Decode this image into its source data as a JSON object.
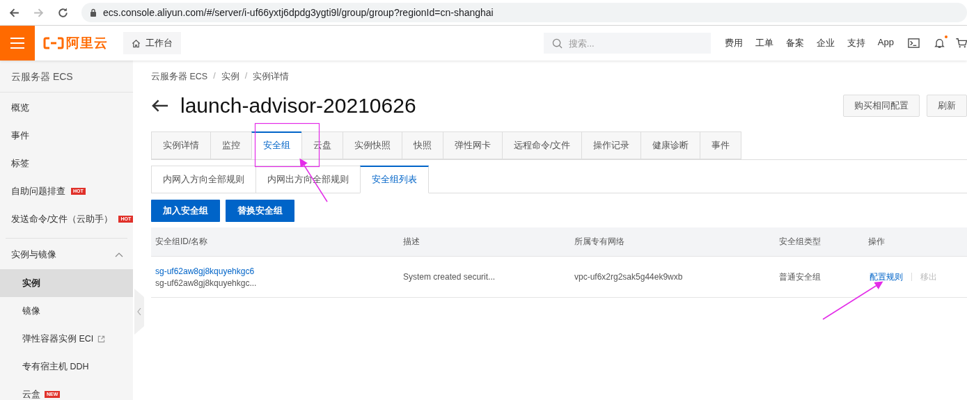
{
  "browser": {
    "url": "ecs.console.aliyun.com/#/server/i-uf66yxtj6dpdg3ygti9l/group/group?regionId=cn-shanghai"
  },
  "header": {
    "logo": "阿里云",
    "workbench": "工作台",
    "search": {
      "placeholder": "搜索..."
    },
    "nav": [
      "费用",
      "工单",
      "备案",
      "企业",
      "支持",
      "App"
    ],
    "notification_dot": true
  },
  "sidebar": {
    "title": "云服务器 ECS",
    "items": [
      {
        "label": "概览"
      },
      {
        "label": "事件"
      },
      {
        "label": "标签"
      },
      {
        "label": "自助问题排查",
        "badge": "HOT"
      },
      {
        "label": "发送命令/文件（云助手）",
        "badge": "HOT"
      }
    ],
    "group": {
      "label": "实例与镜像",
      "expanded": true,
      "children": [
        {
          "label": "实例",
          "selected": true
        },
        {
          "label": "镜像",
          "selected": false
        },
        {
          "label": "弹性容器实例 ECI",
          "selected": false,
          "external": true
        },
        {
          "label": "专有宿主机 DDH",
          "selected": false
        },
        {
          "label": "云盒",
          "selected": false,
          "badge": "NEW"
        }
      ]
    }
  },
  "breadcrumb": {
    "items": [
      "云服务器 ECS",
      "实例",
      "实例详情"
    ],
    "separator": "/"
  },
  "title": "launch-advisor-20210626",
  "actions": [
    "购买相同配置",
    "刷新"
  ],
  "tabs": [
    {
      "label": "实例详情",
      "selected": false
    },
    {
      "label": "监控",
      "selected": false
    },
    {
      "label": "安全组",
      "selected": true
    },
    {
      "label": "云盘",
      "selected": false
    },
    {
      "label": "实例快照",
      "selected": false
    },
    {
      "label": "快照",
      "selected": false
    },
    {
      "label": "弹性网卡",
      "selected": false
    },
    {
      "label": "远程命令/文件",
      "selected": false
    },
    {
      "label": "操作记录",
      "selected": false
    },
    {
      "label": "健康诊断",
      "selected": false
    },
    {
      "label": "事件",
      "selected": false
    }
  ],
  "subtabs": [
    {
      "label": "内网入方向全部规则",
      "selected": false
    },
    {
      "label": "内网出方向全部规则",
      "selected": false
    },
    {
      "label": "安全组列表",
      "selected": true
    }
  ],
  "buttons": [
    "加入安全组",
    "替换安全组"
  ],
  "table": {
    "columns": [
      "安全组ID/名称",
      "描述",
      "所属专有网络",
      "安全组类型",
      "操作"
    ],
    "rows": [
      {
        "id": "sg-uf62aw8gj8kquyehkgc6",
        "name": "sg-uf62aw8gj8kquyehkgc...",
        "description": "System created securit...",
        "vpc": "vpc-uf6x2rg2sak5g44ek9wxb",
        "type": "普通安全组",
        "actions": [
          {
            "label": "配置规则",
            "disabled": false
          },
          {
            "label": "移出",
            "disabled": true
          }
        ]
      }
    ]
  }
}
